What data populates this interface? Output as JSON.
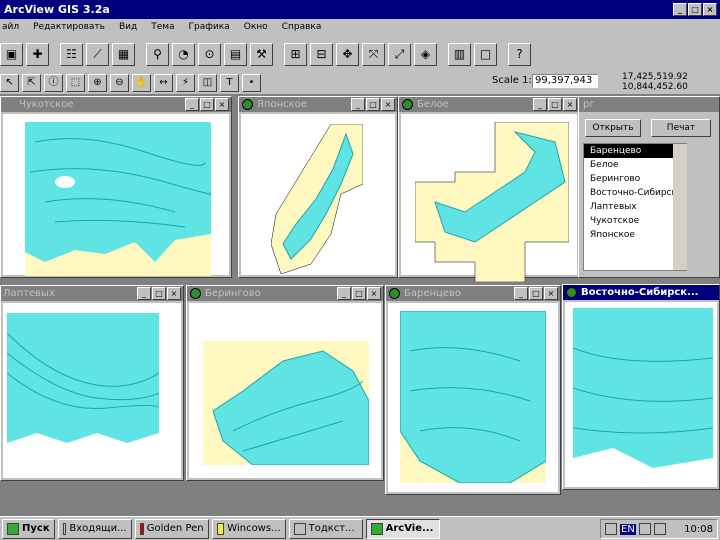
{
  "app": {
    "title": "ArcView GIS 3.2a"
  },
  "window_controls": {
    "minimize": "_",
    "maximize": "□",
    "close": "×"
  },
  "menu": [
    "айл",
    "Редактировать",
    "Вид",
    "Тема",
    "Графика",
    "Окно",
    "Справка"
  ],
  "toolbar1_icons": [
    "save-icon",
    "add-theme-icon",
    "theme-properties-icon",
    "edit-legend-icon",
    "table-icon",
    "find-icon",
    "query-icon",
    "locate-icon",
    "chart-icon",
    "hammer-icon",
    "layout-icon",
    "layout-icon-2",
    "pan-icon",
    "zoom-full-icon",
    "zoom-selected-icon",
    "select-features-icon",
    "map-icon",
    "help-icon"
  ],
  "toolbar2_icons": [
    "pointer-icon",
    "vertex-icon",
    "identify-icon",
    "select-icon",
    "zoom-in-icon",
    "zoom-out-icon",
    "pan-hand-icon",
    "measure-icon",
    "hotlink-icon",
    "area-icon",
    "text-icon",
    "point-icon"
  ],
  "scale": {
    "label": "Scale 1:",
    "value": "99,397,943"
  },
  "coords": {
    "x": "17,425,519.92",
    "y": "10,844,452.60"
  },
  "windows": [
    {
      "title": "Чукотское"
    },
    {
      "title": "Японское"
    },
    {
      "title": "Белое"
    },
    {
      "title": "Лаптевых"
    },
    {
      "title": "Берингово"
    },
    {
      "title": "Баренцево"
    },
    {
      "title": "Восточно-Сибирск..."
    }
  ],
  "catalog": {
    "title_fragment": "рг",
    "open_button": "Открыть",
    "print_button": "Печат",
    "items": [
      "Баренцево",
      "Белое",
      "Берингово",
      "Восточно-Сибирск",
      "Лаптевых",
      "Чукотское",
      "Японское"
    ],
    "selected_index": 0
  },
  "taskbar": {
    "start": "Пуск",
    "tasks": [
      {
        "label": "Входящи..."
      },
      {
        "label": "Golden Pen"
      },
      {
        "label": "Wincows..."
      },
      {
        "label": "Тодкст..."
      },
      {
        "label": "ArcVie..."
      }
    ],
    "active_task": 4,
    "tray": {
      "lang": "EN",
      "clock": "10:08"
    }
  },
  "colors": {
    "water": "#5fe3e3",
    "contour": "#1aa6a6",
    "land": "#fff8c0",
    "title_active": "#00007f",
    "title_inactive": "#808080"
  }
}
